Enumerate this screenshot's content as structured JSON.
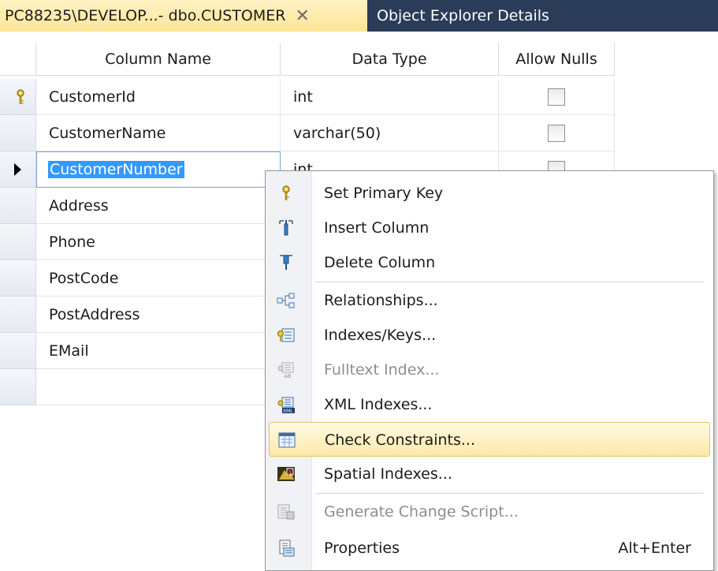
{
  "tabs": {
    "active": {
      "title": "PC88235\\DEVELOP...- dbo.CUSTOMER",
      "close": "✕"
    },
    "inactive": {
      "title": "Object Explorer Details"
    }
  },
  "grid": {
    "headers": {
      "column_name": "Column Name",
      "data_type": "Data Type",
      "allow_nulls": "Allow Nulls"
    },
    "rows": [
      {
        "name": "CustomerId",
        "type": "int",
        "allow_nulls": false,
        "primary_key": true
      },
      {
        "name": "CustomerName",
        "type": "varchar(50)",
        "allow_nulls": false
      },
      {
        "name": "CustomerNumber",
        "type": "int",
        "allow_nulls": false,
        "editing": true
      },
      {
        "name": "Address",
        "type": "",
        "allow_nulls": false
      },
      {
        "name": "Phone",
        "type": "",
        "allow_nulls": false
      },
      {
        "name": "PostCode",
        "type": "",
        "allow_nulls": false
      },
      {
        "name": "PostAddress",
        "type": "",
        "allow_nulls": false
      },
      {
        "name": "EMail",
        "type": "",
        "allow_nulls": false
      },
      {
        "name": "",
        "type": "",
        "allow_nulls": false
      }
    ]
  },
  "context_menu": {
    "items": [
      {
        "label": "Set Primary Key",
        "icon": "key-icon"
      },
      {
        "label": "Insert Column",
        "icon": "insert-column-icon"
      },
      {
        "label": "Delete Column",
        "icon": "delete-column-icon"
      },
      {
        "label": "Relationships...",
        "icon": "relationships-icon"
      },
      {
        "label": "Indexes/Keys...",
        "icon": "indexes-keys-icon"
      },
      {
        "label": "Fulltext Index...",
        "icon": "fulltext-index-icon",
        "disabled": true
      },
      {
        "label": "XML Indexes...",
        "icon": "xml-indexes-icon"
      },
      {
        "label": "Check Constraints...",
        "icon": "check-constraints-icon",
        "highlighted": true
      },
      {
        "label": "Spatial Indexes...",
        "icon": "spatial-indexes-icon"
      },
      {
        "label": "Generate Change Script...",
        "icon": "generate-script-icon",
        "disabled": true
      },
      {
        "label": "Properties",
        "icon": "properties-icon",
        "shortcut": "Alt+Enter"
      }
    ]
  },
  "colors": {
    "tab_strip": "#2b3c59",
    "active_tab": "#fde597",
    "selection": "#3399ff",
    "menu_highlight": "#fce9a8"
  }
}
